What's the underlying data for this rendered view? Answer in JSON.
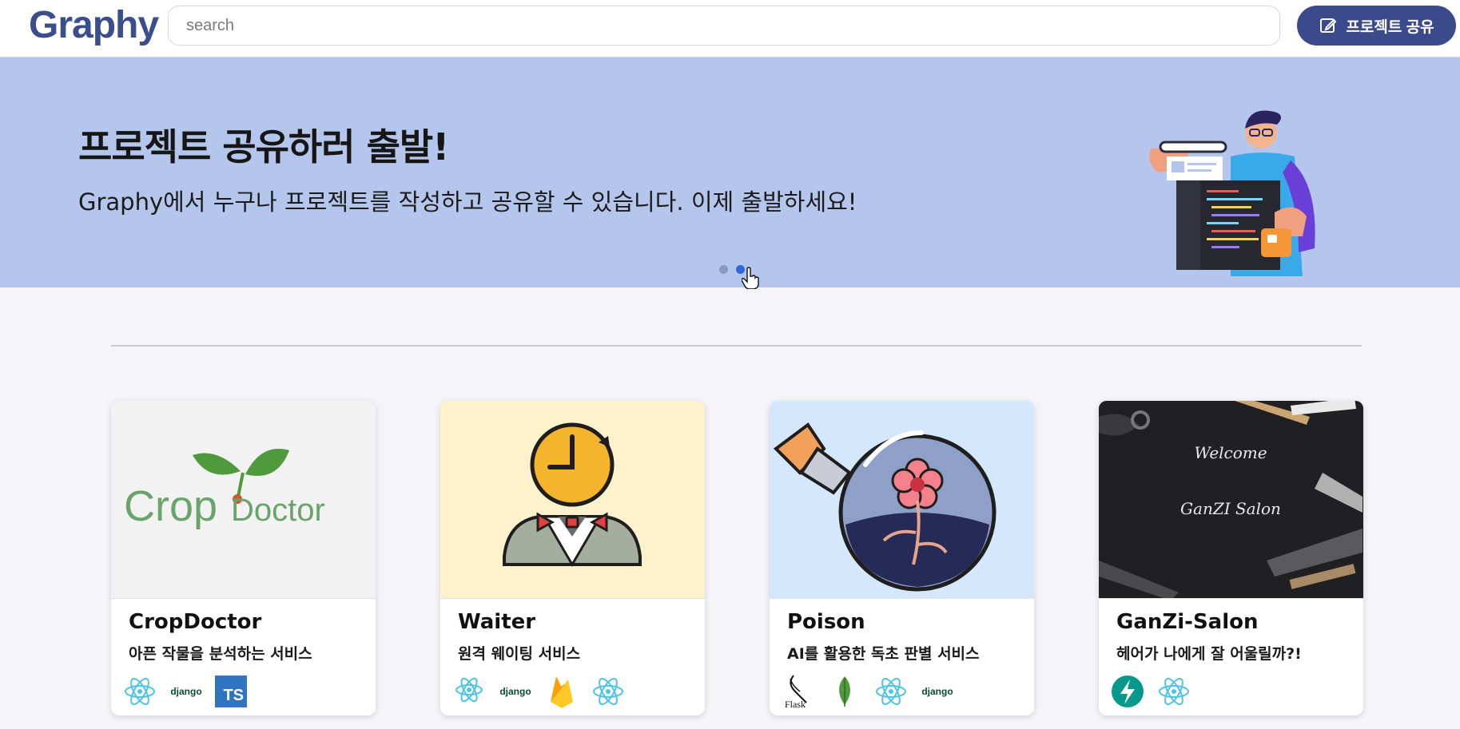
{
  "header": {
    "logo": "Graphy",
    "search_placeholder": "search",
    "share_button": "프로젝트 공유"
  },
  "banner": {
    "title": "프로젝트 공유하러 출발!",
    "subtitle": "Graphy에서 누구나 프로젝트를 작성하고 공유할 수 있습니다. 이제 출발하세요!",
    "slides": 2,
    "active_slide": 2
  },
  "projects": [
    {
      "title": "CropDoctor",
      "description": "아픈 작물을 분석하는 서비스",
      "image_text": "CropDoctor",
      "stack": [
        "react-icon",
        "django-logo",
        "typescript-logo"
      ]
    },
    {
      "title": "Waiter",
      "description": "원격 웨이팅 서비스",
      "stack": [
        "react-native-icon",
        "django-logo",
        "firebase-icon",
        "react-icon"
      ]
    },
    {
      "title": "Poison",
      "description": "AI를 활용한 독초 판별 서비스",
      "stack": [
        "flask-icon",
        "mongodb-icon",
        "react-icon",
        "django-logo"
      ]
    },
    {
      "title": "GanZi-Salon",
      "description": "헤어가 나에게 잘 어울릴까?!",
      "image_text_1": "Welcome",
      "image_text_2": "GanZI Salon",
      "stack": [
        "fastapi-icon",
        "react-icon"
      ]
    }
  ],
  "stack_labels": {
    "django": "django",
    "ts": "TS",
    "flask": "Flask"
  },
  "colors": {
    "brand": "#3b4a8a",
    "banner_bg": "#b4c6ec",
    "page_bg": "#f4f4f9",
    "dot_active": "#2f66d9"
  }
}
